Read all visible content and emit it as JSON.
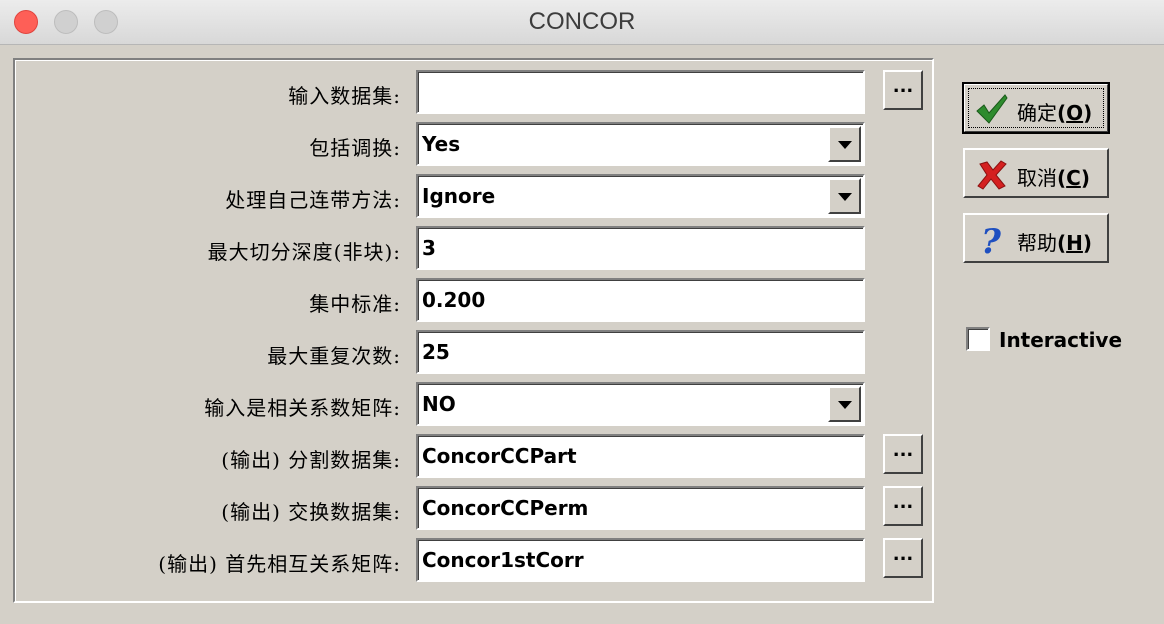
{
  "window": {
    "title": "CONCOR"
  },
  "form": {
    "rows": [
      {
        "label": "输入数据集:",
        "value": "",
        "control": "text-browse"
      },
      {
        "label": "包括调换:",
        "value": "Yes",
        "control": "dropdown"
      },
      {
        "label": "处理自己连带方法:",
        "value": "Ignore",
        "control": "dropdown"
      },
      {
        "label": "最大切分深度(非块):",
        "value": "3",
        "control": "text"
      },
      {
        "label": "集中标准:",
        "value": "0.200",
        "control": "text"
      },
      {
        "label": "最大重复次数:",
        "value": "25",
        "control": "text"
      },
      {
        "label": "输入是相关系数矩阵:",
        "value": "NO",
        "control": "dropdown"
      },
      {
        "label": "(输出) 分割数据集:",
        "value": "ConcorCCPart",
        "control": "text-browse"
      },
      {
        "label": "(输出) 交换数据集:",
        "value": "ConcorCCPerm",
        "control": "text-browse"
      },
      {
        "label": "(输出) 首先相互关系矩阵:",
        "value": "Concor1stCorr",
        "control": "text-browse"
      }
    ],
    "browse_label": "..."
  },
  "buttons": {
    "ok": {
      "label": "确定",
      "paren_open": "(",
      "key": "O",
      "paren_close": ")",
      "icon": "checkmark-icon"
    },
    "cancel": {
      "label": "取消",
      "paren_open": "(",
      "key": "C",
      "paren_close": ")",
      "icon": "red-x-icon"
    },
    "help": {
      "label": "帮助",
      "paren_open": "(",
      "key": "H",
      "paren_close": ")",
      "icon": "question-icon"
    }
  },
  "interactive": {
    "label": "Interactive",
    "checked": false
  },
  "colors": {
    "face": "#d4d0c8",
    "close": "#fe5f57",
    "check": "#2e8b2e",
    "cross": "#d42020",
    "question": "#1e4fc0"
  }
}
